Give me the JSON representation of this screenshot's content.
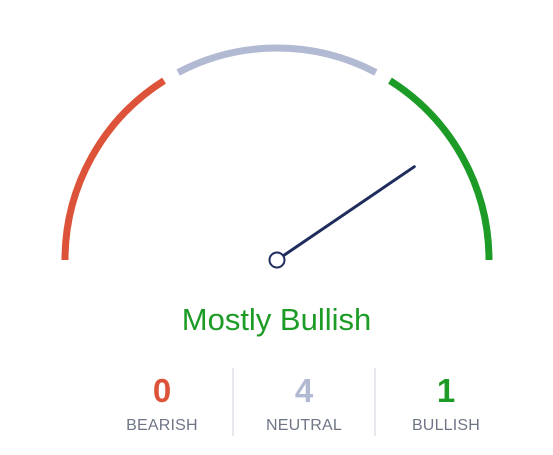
{
  "gauge": {
    "verdict": "Mostly Bullish",
    "needle_fraction": 0.81,
    "segments": [
      {
        "name": "bearish",
        "color": "#dc5339"
      },
      {
        "name": "neutral",
        "color": "#b1b9d3"
      },
      {
        "name": "bullish",
        "color": "#1d9b27"
      }
    ],
    "needle_color": "#1f2d5c",
    "verdict_color": "#1d9b27"
  },
  "counts": [
    {
      "key": "bearish",
      "value": "0",
      "label": "BEARISH",
      "color": "#dc5339"
    },
    {
      "key": "neutral",
      "value": "4",
      "label": "NEUTRAL",
      "color": "#b1b9d3"
    },
    {
      "key": "bullish",
      "value": "1",
      "label": "BULLISH",
      "color": "#1d9b27"
    }
  ]
}
